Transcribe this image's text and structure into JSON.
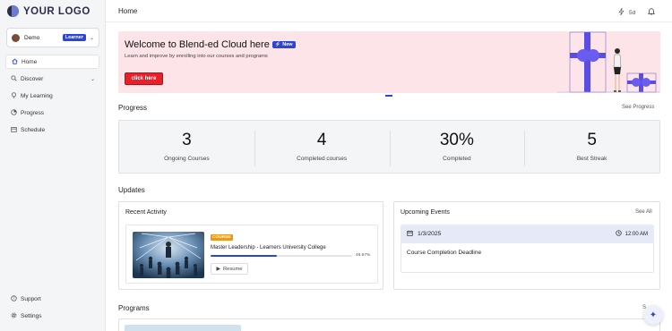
{
  "brand": {
    "logo_text": "YOUR LOGO"
  },
  "user": {
    "name": "Demo",
    "role": "Learner"
  },
  "sidebar": {
    "items": [
      {
        "label": "Home",
        "icon": "home-icon",
        "active": true
      },
      {
        "label": "Discover",
        "icon": "search-icon",
        "active": false
      },
      {
        "label": "My Learning",
        "icon": "lightbulb-icon",
        "active": false
      },
      {
        "label": "Progress",
        "icon": "progress-icon",
        "active": false
      },
      {
        "label": "Schedule",
        "icon": "calendar-icon",
        "active": false
      }
    ],
    "bottom_items": [
      {
        "label": "Support",
        "icon": "help-icon"
      },
      {
        "label": "Settings",
        "icon": "gear-icon"
      }
    ]
  },
  "header": {
    "title": "Home",
    "streak": "5d"
  },
  "banner": {
    "title": "Welcome to Blend-ed Cloud here",
    "badge": "New",
    "subtitle": "Learn and improve by enrolling into our courses and programs",
    "button": "click here"
  },
  "progress": {
    "title": "Progress",
    "link": "See Progress",
    "stats": [
      {
        "value": "3",
        "label": "Ongoing Courses"
      },
      {
        "value": "4",
        "label": "Completed courses"
      },
      {
        "value": "30%",
        "label": "Completed"
      },
      {
        "value": "5",
        "label": "Best Streak"
      }
    ]
  },
  "updates": {
    "title": "Updates",
    "recent_activity": {
      "title": "Recent Activity",
      "course": {
        "tag": "COURSE",
        "name": "Master Leadership - Learners University College",
        "progress_text": "46.67%",
        "progress_value": 0.4667,
        "button": "Resume"
      }
    },
    "upcoming_events": {
      "title": "Upcoming Events",
      "link": "See All",
      "event": {
        "date": "1/3/2025",
        "time": "12:00 AM",
        "name": "Course Completion Deadline"
      }
    }
  },
  "programs": {
    "title": "Programs",
    "link": "S"
  },
  "colors": {
    "accent": "#2b46d6",
    "banner_bg": "#fce4e8",
    "button_red": "#e8202a"
  }
}
